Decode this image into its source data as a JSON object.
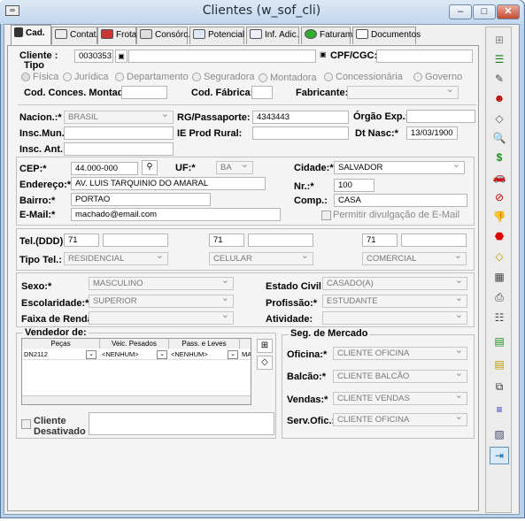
{
  "window": {
    "title": "Clientes (w_sof_cli)",
    "minimize": "–",
    "maximize": "□",
    "close": "✕"
  },
  "tabs": [
    {
      "label": "Cad."
    },
    {
      "label": "Contat."
    },
    {
      "label": "Frota"
    },
    {
      "label": "Consórc."
    },
    {
      "label": "Potencial"
    },
    {
      "label": "Inf. Adic."
    },
    {
      "label": "Faturam."
    },
    {
      "label": "Documentos"
    }
  ],
  "cliente": {
    "label": "Cliente :",
    "code": "0030353",
    "name": "",
    "cpf_label": "CPF/CGC:*",
    "cpf": ""
  },
  "tipo": {
    "title": "Tipo",
    "options": [
      "Física",
      "Jurídica",
      "Departamento",
      "Seguradora",
      "Montadora",
      "Concessionária",
      "Governo"
    ]
  },
  "conces": {
    "label": "Cod. Conces. Montad.:",
    "value": ""
  },
  "fabrica": {
    "label": "Cod. Fábrica:",
    "value": ""
  },
  "fabricante": {
    "label": "Fabricante:",
    "value": ""
  },
  "nacion": {
    "label": "Nacion.:*",
    "value": "BRASIL"
  },
  "rg": {
    "label": "RG/Passaporte:",
    "value": "4343443"
  },
  "orgao": {
    "label": "Órgão Exp.:",
    "value": ""
  },
  "inscmun": {
    "label": "Insc.Mun.:",
    "value": ""
  },
  "ieprod": {
    "label": "IE Prod Rural:",
    "value": ""
  },
  "dtnasc": {
    "label": "Dt Nasc:*",
    "value": "13/03/1900"
  },
  "inscant": {
    "label": "Insc. Ant.:",
    "value": ""
  },
  "cep": {
    "label": "CEP:*",
    "value": "44.000-000"
  },
  "uf": {
    "label": "UF:*",
    "value": "BA"
  },
  "cidade": {
    "label": "Cidade:*",
    "value": "SALVADOR"
  },
  "endereco": {
    "label": "Endereço:*",
    "value": "AV. LUIS TARQUINIO DO AMARAL"
  },
  "nr": {
    "label": "Nr.:*",
    "value": "100"
  },
  "bairro": {
    "label": "Bairro:*",
    "value": "PORTAO"
  },
  "comp": {
    "label": "Comp.:",
    "value": "CASA"
  },
  "email": {
    "label": "E-Mail:*",
    "value": "machado@email.com"
  },
  "permitir": {
    "label": "Permitir divulgação de E-Mail"
  },
  "tel": {
    "label": "Tel.(DDD):",
    "tipo_label": "Tipo Tel.:",
    "entries": [
      {
        "ddd": "71",
        "num": "",
        "tipo": "RESIDENCIAL"
      },
      {
        "ddd": "71",
        "num": "",
        "tipo": "CELULAR"
      },
      {
        "ddd": "71",
        "num": "",
        "tipo": "COMERCIAL"
      }
    ]
  },
  "sexo": {
    "label": "Sexo:*",
    "value": "MASCULINO"
  },
  "civil": {
    "label": "Estado Civil:*",
    "value": "CASADO(A)"
  },
  "escol": {
    "label": "Escolaridade:*",
    "value": "SUPERIOR"
  },
  "prof": {
    "label": "Profissão:*",
    "value": "ESTUDANTE"
  },
  "renda": {
    "label": "Faixa de Renda:",
    "value": ""
  },
  "ativ": {
    "label": "Atividade:",
    "value": ""
  },
  "vendedor": {
    "title": "Vendedor de:",
    "headers": [
      "Peças",
      "Veic. Pesados",
      "Pass. e Leves",
      "MA"
    ],
    "row": [
      "DN2112",
      "<NENHUM>",
      "<NENHUM>",
      "MA"
    ]
  },
  "seg": {
    "title": "Seg. de Mercado",
    "oficina_label": "Oficina:*",
    "oficina": "CLIENTE OFICINA",
    "balcao_label": "Balcão:*",
    "balcao": "CLIENTE BALCÃO",
    "vendas_label": "Vendas:*",
    "vendas": "CLIENTE VENDAS",
    "serv_label": "Serv.Ofic.:",
    "serv": "CLIENTE OFICINA"
  },
  "desativado": {
    "label1": "Cliente",
    "label2": "Desativado"
  },
  "toolbar": [
    {
      "icon": "grid-icon",
      "glyph": "⊞"
    },
    {
      "icon": "list-icon",
      "glyph": "☰"
    },
    {
      "icon": "edit-icon",
      "glyph": "✎"
    },
    {
      "icon": "user-icon",
      "glyph": "☻"
    },
    {
      "icon": "eraser-icon",
      "glyph": "◇"
    },
    {
      "icon": "preview-icon",
      "glyph": "🔍"
    },
    {
      "icon": "money-bag-icon",
      "glyph": "$"
    },
    {
      "icon": "car-icon",
      "glyph": "🚗"
    },
    {
      "icon": "no-icon",
      "glyph": "⊘"
    },
    {
      "icon": "thumbs-down-icon",
      "glyph": "👎"
    },
    {
      "icon": "stop-icon",
      "glyph": "⬣"
    },
    {
      "icon": "eraser2-icon",
      "glyph": "◇"
    },
    {
      "icon": "calculator-icon",
      "glyph": "▦"
    },
    {
      "icon": "print-icon",
      "glyph": "⎙"
    },
    {
      "icon": "group-icon",
      "glyph": "☷"
    },
    {
      "icon": "doc-green-icon",
      "glyph": "▤"
    },
    {
      "icon": "doc-yellow-icon",
      "glyph": "▤"
    },
    {
      "icon": "copy-icon",
      "glyph": "⧉"
    },
    {
      "icon": "align-icon",
      "glyph": "≡"
    },
    {
      "icon": "photo-icon",
      "glyph": "▨"
    },
    {
      "icon": "exit-icon",
      "glyph": "⇥"
    }
  ]
}
